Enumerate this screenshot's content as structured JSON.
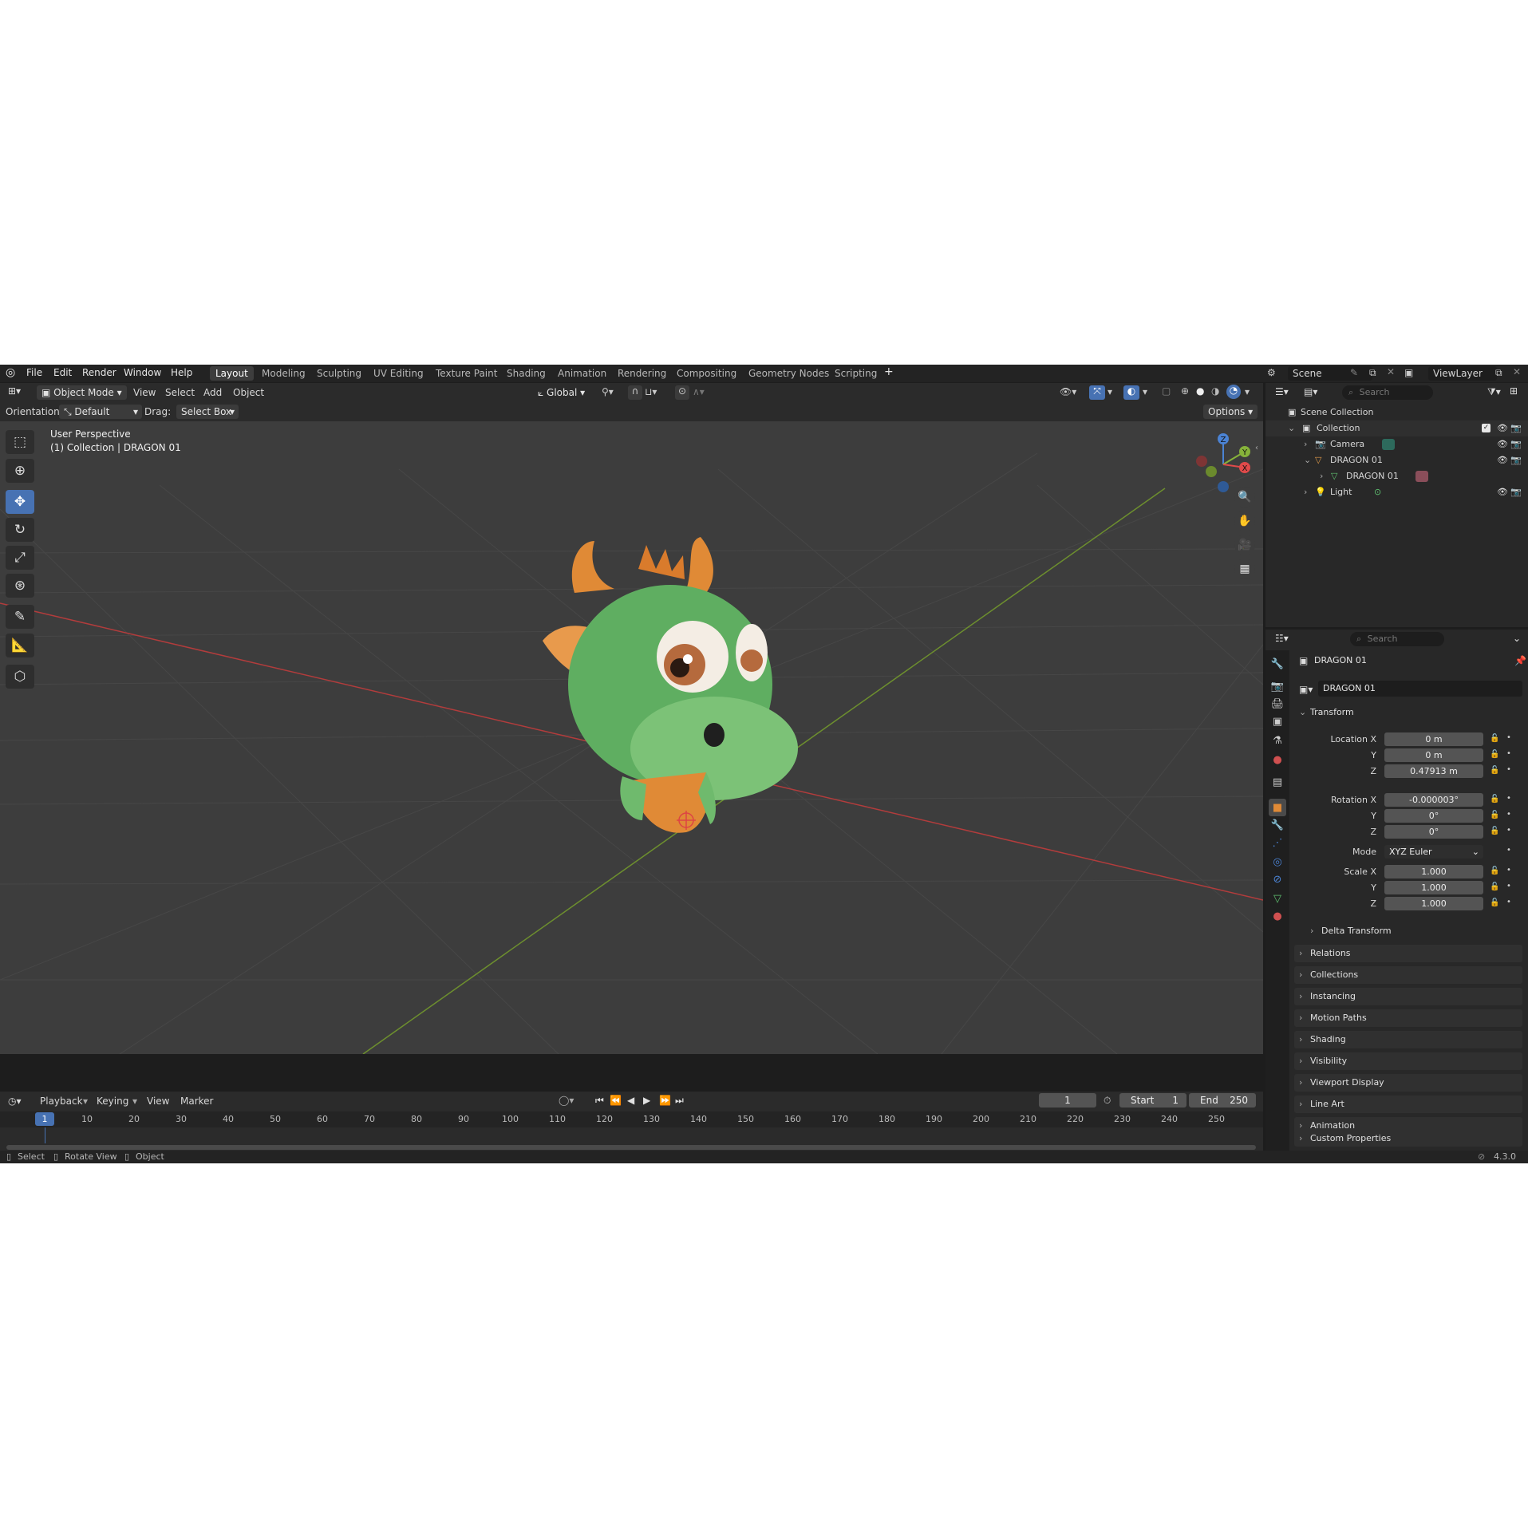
{
  "menubar": {
    "menus": [
      "File",
      "Edit",
      "Render",
      "Window",
      "Help"
    ],
    "workspaces": [
      "Layout",
      "Modeling",
      "Sculpting",
      "UV Editing",
      "Texture Paint",
      "Shading",
      "Animation",
      "Rendering",
      "Compositing",
      "Geometry Nodes",
      "Scripting"
    ],
    "add_workspace": "+",
    "scene": "Scene",
    "view_layer": "ViewLayer"
  },
  "viewport_header": {
    "mode": "Object Mode",
    "menus": [
      "View",
      "Select",
      "Add",
      "Object"
    ],
    "transform_orientation": "Global"
  },
  "tool_settings": {
    "orientation_label": "Orientation:",
    "orientation_value": "Default",
    "drag_label": "Drag:",
    "drag_value": "Select Box",
    "options": "Options"
  },
  "viewport": {
    "perspective": "User Perspective",
    "context": "(1) Collection | DRAGON 01",
    "gizmo_axes": {
      "x": "X",
      "y": "Y",
      "z": "Z"
    }
  },
  "outliner": {
    "search_placeholder": "Search",
    "scene_collection": "Scene Collection",
    "rows": [
      {
        "label": "Collection",
        "icon": "collection-icon"
      },
      {
        "label": "Camera",
        "icon": "camera-icon"
      },
      {
        "label": "DRAGON 01",
        "icon": "mesh-object-icon"
      },
      {
        "label": "DRAGON 01",
        "icon": "mesh-data-icon"
      },
      {
        "label": "Light",
        "icon": "light-icon"
      }
    ]
  },
  "properties": {
    "search_placeholder": "Search",
    "object_name": "DRAGON 01",
    "datablock_name": "DRAGON 01",
    "transform": {
      "title": "Transform",
      "location_label": "Location X",
      "location": [
        "0 m",
        "0 m",
        "0.47913 m"
      ],
      "rotation_label": "Rotation X",
      "rotation": [
        "-0.000003°",
        "0°",
        "0°"
      ],
      "mode_label": "Mode",
      "mode_value": "XYZ Euler",
      "scale_label": "Scale X",
      "scale": [
        "1.000",
        "1.000",
        "1.000"
      ],
      "axis_y": "Y",
      "axis_z": "Z",
      "delta": "Delta Transform"
    },
    "panels": [
      "Relations",
      "Collections",
      "Instancing",
      "Motion Paths",
      "Shading",
      "Visibility",
      "Viewport Display",
      "Line Art",
      "Animation",
      "Custom Properties"
    ]
  },
  "timeline": {
    "menus": [
      "Playback",
      "Keying",
      "View",
      "Marker"
    ],
    "current_frame": "1",
    "start_label": "Start",
    "start_value": "1",
    "end_label": "End",
    "end_value": "250",
    "ruler": [
      "10",
      "20",
      "30",
      "40",
      "50",
      "60",
      "70",
      "80",
      "90",
      "100",
      "110",
      "120",
      "130",
      "140",
      "150",
      "160",
      "170",
      "180",
      "190",
      "200",
      "210",
      "220",
      "230",
      "240",
      "250"
    ],
    "playhead": "1"
  },
  "statusbar": {
    "hints": [
      "Select",
      "Rotate View",
      "Object"
    ],
    "version": "4.3.0"
  },
  "colors": {
    "accent": "#4772b3",
    "x_axis": "#e04a4a",
    "y_axis": "#86b23a",
    "z_axis": "#4b83d4",
    "dragon_green": "#5fae61",
    "dragon_orange": "#e08a36"
  }
}
